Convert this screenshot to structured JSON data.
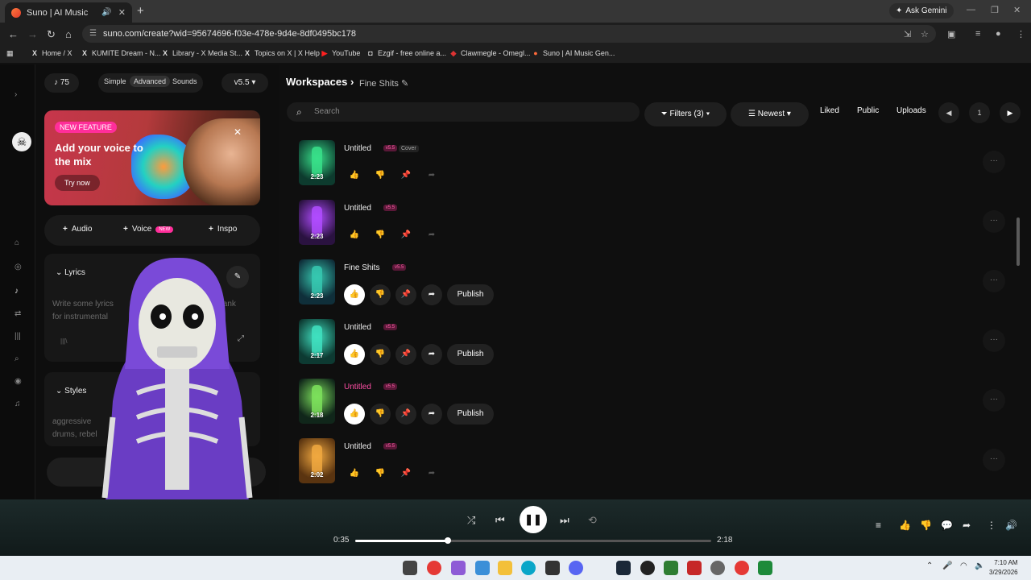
{
  "browser": {
    "tab_title": "Suno | AI Music",
    "new_tab": "+",
    "ask_gemini": "Ask Gemini",
    "url": "suno.com/create?wid=95674696-f03e-478e-9d4e-8df0495bc178",
    "bookmarks": [
      "Home / X",
      "KUMITE Dream - N...",
      "Library - X Media St...",
      "Topics on X | X Help",
      "YouTube",
      "Ezgif - free online a...",
      "Clawmegle - Omegl...",
      "Suno | AI Music Gen..."
    ]
  },
  "panel": {
    "credits": "75",
    "modes": [
      "Simple",
      "Advanced",
      "Sounds"
    ],
    "version": "v5.5",
    "promo": {
      "badge": "NEW FEATURE",
      "text": "Add your voice to the mix",
      "cta": "Try now"
    },
    "add": {
      "audio": "Audio",
      "voice": "Voice",
      "voice_badge": "NEW",
      "inspo": "Inspo"
    },
    "lyrics": {
      "header": "Lyrics",
      "placeholder_a": "Write some lyrics",
      "placeholder_b": "blank",
      "placeholder_c": "for instrumental",
      "snippet": "|||\\"
    },
    "styles": {
      "header": "Styles",
      "text_a": "aggressive",
      "text_b": "drums, rebel"
    }
  },
  "main": {
    "breadcrumb": "Workspaces",
    "workspace": "Fine Shits",
    "search_placeholder": "Search",
    "filters": "Filters (3)",
    "sort": "Newest",
    "tabs": [
      "Liked",
      "Public",
      "Uploads"
    ],
    "page": "1",
    "songs": [
      {
        "title": "Untitled",
        "version": "v5.5",
        "tag": "Cover",
        "duration": "2:23",
        "active": false,
        "publish": false,
        "pink": false,
        "colors": [
          "#0d3b2e",
          "#38e08a"
        ]
      },
      {
        "title": "Untitled",
        "version": "v5.5",
        "tag": "",
        "duration": "2:23",
        "active": false,
        "publish": false,
        "pink": false,
        "colors": [
          "#2a1240",
          "#b04cff"
        ]
      },
      {
        "title": "Fine Shits",
        "version": "v5.5",
        "tag": "",
        "duration": "2:23",
        "active": true,
        "publish": true,
        "pink": false,
        "colors": [
          "#0f2f3a",
          "#36c8b0"
        ]
      },
      {
        "title": "Untitled",
        "version": "v5.5",
        "tag": "",
        "duration": "2:17",
        "active": true,
        "publish": true,
        "pink": false,
        "colors": [
          "#0d3a32",
          "#40e0c0"
        ]
      },
      {
        "title": "Untitled",
        "version": "v5.5",
        "tag": "",
        "duration": "2:18",
        "active": true,
        "publish": true,
        "pink": true,
        "colors": [
          "#10261a",
          "#7de05c"
        ]
      },
      {
        "title": "Untitled",
        "version": "v5.5",
        "tag": "",
        "duration": "2:02",
        "active": false,
        "publish": false,
        "pink": false,
        "colors": [
          "#5a3410",
          "#f0a840"
        ]
      }
    ],
    "publish_label": "Publish"
  },
  "player": {
    "elapsed": "0:35",
    "total": "2:18",
    "progress": 0.26
  },
  "taskbar": {
    "time": "7:10 AM",
    "date": "3/29/2026"
  }
}
